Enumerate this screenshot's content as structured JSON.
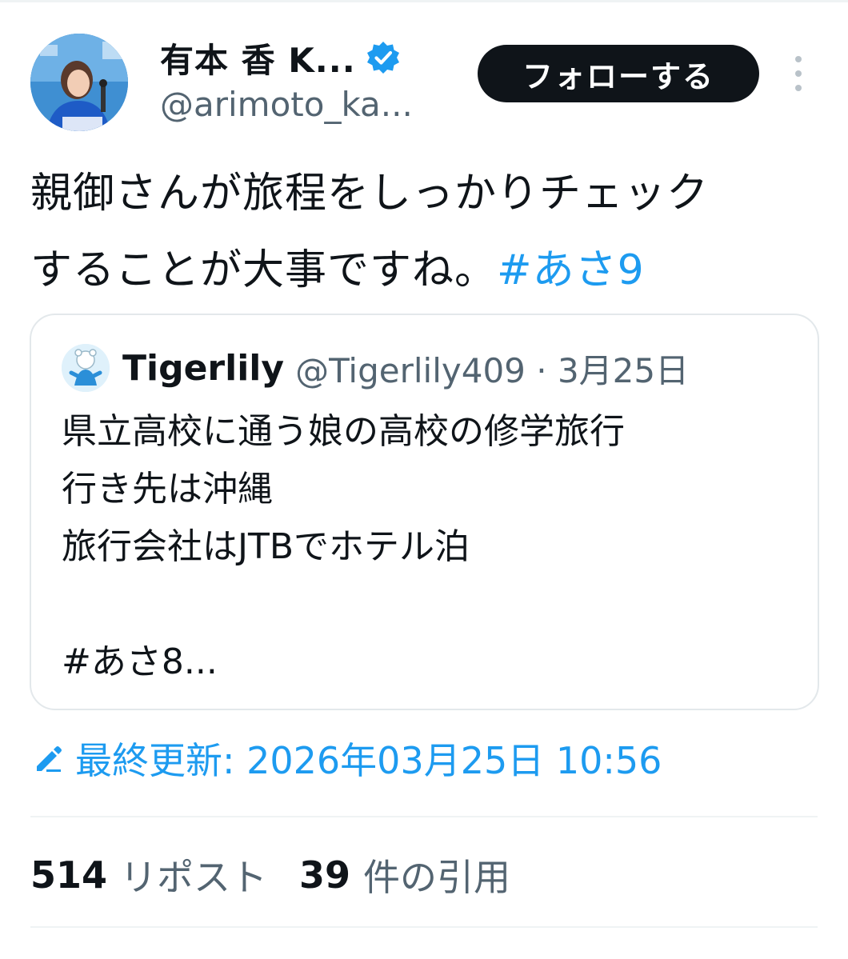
{
  "tweet": {
    "author": {
      "display_name": "有本 香 K...",
      "handle": "@arimoto_ka...",
      "verified_icon": "verified-badge-icon"
    },
    "follow_label": "フォローする",
    "more_icon": "more-vertical-icon",
    "text_line1": "親御さんが旅程をしっかりチェック",
    "text_line2": "することが大事ですね。",
    "hashtag": "#あさ9"
  },
  "quote": {
    "name": "Tigerlily",
    "handle_date": "@Tigerlily409 · 3月25日",
    "lines": [
      "県立高校に通う娘の高校の修学旅行",
      "行き先は沖縄",
      "旅行会社はJTBでホテル泊",
      "",
      "#あさ8..."
    ]
  },
  "edited": {
    "icon": "pencil-edit-icon",
    "text": "最終更新: 2026年03月25日 10:56"
  },
  "stats": {
    "reposts_count": "514",
    "reposts_label": "リポスト",
    "quotes_count": "39",
    "quotes_label": "件の引用"
  },
  "colors": {
    "accent": "#1d9bf0",
    "text": "#0f1419",
    "secondary": "#536471",
    "border": "#e3e8eb"
  }
}
